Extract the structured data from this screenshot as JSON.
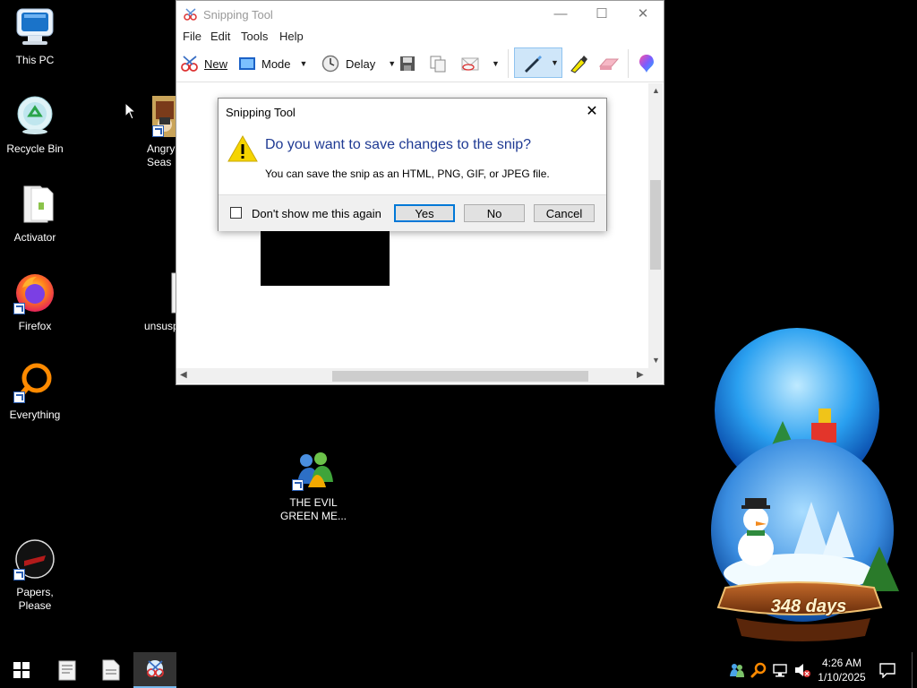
{
  "desktop": {
    "icons": [
      {
        "label": "This PC",
        "icon": "computer-icon"
      },
      {
        "label": "Recycle Bin",
        "icon": "recycle-bin-icon"
      },
      {
        "label": "Activator",
        "icon": "file-icon"
      },
      {
        "label": "Firefox",
        "icon": "firefox-icon"
      },
      {
        "label": "Everything",
        "icon": "search-icon"
      },
      {
        "label": "Papers, Please",
        "icon": "papers-please-icon"
      },
      {
        "label": "Angry",
        "label2": "Seas",
        "icon": "game-icon"
      },
      {
        "label": "unsusp",
        "icon": "file-icon"
      },
      {
        "label": "THE EVIL",
        "label2": "GREEN ME...",
        "icon": "messenger-icon"
      }
    ],
    "widget": {
      "days_label": "348 days"
    }
  },
  "snipping_tool": {
    "title": "Snipping Tool",
    "menu": [
      "File",
      "Edit",
      "Tools",
      "Help"
    ],
    "toolbar": {
      "new_label": "New",
      "mode_label": "Mode",
      "delay_label": "Delay"
    },
    "window_controls": {
      "minimize": "—",
      "maximize": "☐",
      "close": "✕"
    }
  },
  "dialog": {
    "title": "Snipping Tool",
    "close": "✕",
    "heading": "Do you want to save changes to the snip?",
    "message": "You can save the snip as an HTML, PNG, GIF, or JPEG file.",
    "checkbox_label": "Don't show me this again",
    "checkbox_checked": false,
    "buttons": {
      "yes": "Yes",
      "no": "No",
      "cancel": "Cancel"
    }
  },
  "taskbar": {
    "clock_time": "4:26 AM",
    "clock_date": "1/10/2025"
  },
  "colors": {
    "dialog_heading": "#1f3a93",
    "accent": "#0078d7",
    "warning": "#f5d400"
  }
}
